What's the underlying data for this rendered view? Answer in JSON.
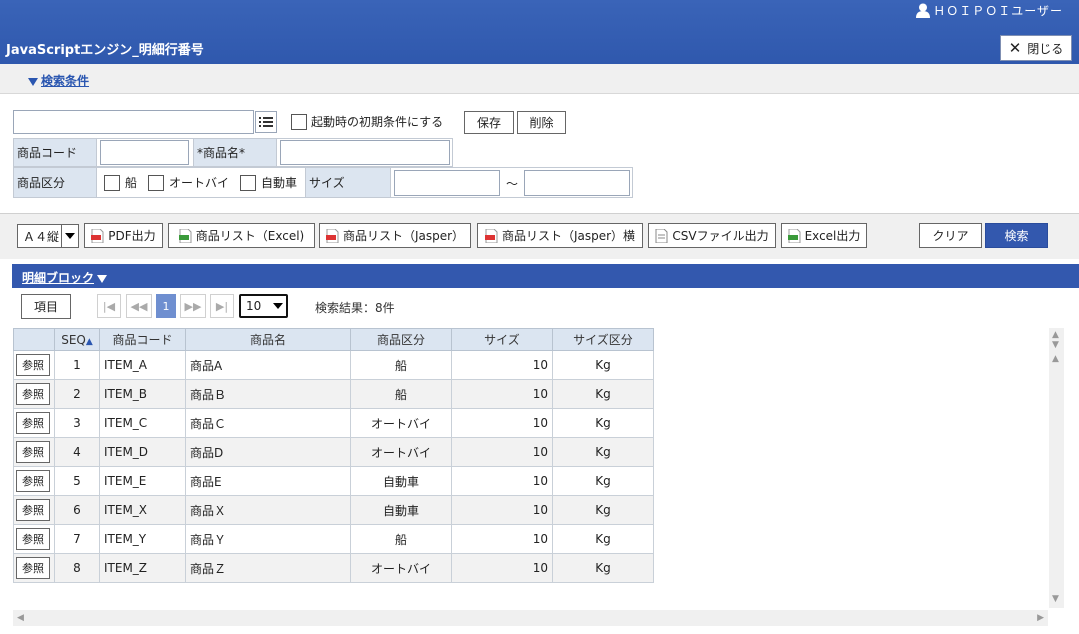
{
  "header": {
    "user": "ＨＯＩＰＯＩユーザー",
    "title": "JavaScriptエンジン_明細行番号",
    "close_label": "閉じる"
  },
  "condition": {
    "toggle_label": "検索条件",
    "preset_value": "",
    "startup_checkbox_label": "起動時の初期条件にする",
    "save_label": "保存",
    "delete_label": "削除",
    "product_code_label": "商品コード",
    "product_code_value": "",
    "product_name_label": "*商品名*",
    "product_name_value": "",
    "category_label": "商品区分",
    "category_options": [
      "船",
      "オートバイ",
      "自動車"
    ],
    "size_label": "サイズ",
    "size_from": "",
    "size_to": "",
    "range_sep": "～"
  },
  "toolbar": {
    "paper_select": "Ａ４縦",
    "pdf_label": "PDF出力",
    "excel_list_label": "商品リスト（Excel)",
    "jasper_list_label": "商品リスト（Jasper）",
    "jasper_list_h_label": "商品リスト（Jasper）横",
    "csv_label": "CSVファイル出力",
    "excel_label": "Excel出力",
    "clear_label": "クリア",
    "search_label": "検索"
  },
  "detail": {
    "toggle_label": "明細ブロック",
    "items_label": "項目",
    "current_page": "1",
    "page_size": "10",
    "result_text": "検索結果：8件"
  },
  "table": {
    "headers": [
      "",
      "SEQ",
      "商品コード",
      "商品名",
      "商品区分",
      "サイズ",
      "サイズ区分"
    ],
    "ref_label": "参照",
    "rows": [
      {
        "seq": "1",
        "code": "ITEM_A",
        "name": "商品A",
        "cat": "船",
        "size": "10",
        "unit": "Kg"
      },
      {
        "seq": "2",
        "code": "ITEM_B",
        "name": "商品Ｂ",
        "cat": "船",
        "size": "10",
        "unit": "Kg"
      },
      {
        "seq": "3",
        "code": "ITEM_C",
        "name": "商品Ｃ",
        "cat": "オートバイ",
        "size": "10",
        "unit": "Kg"
      },
      {
        "seq": "4",
        "code": "ITEM_D",
        "name": "商品D",
        "cat": "オートバイ",
        "size": "10",
        "unit": "Kg"
      },
      {
        "seq": "5",
        "code": "ITEM_E",
        "name": "商品E",
        "cat": "自動車",
        "size": "10",
        "unit": "Kg"
      },
      {
        "seq": "6",
        "code": "ITEM_X",
        "name": "商品Ｘ",
        "cat": "自動車",
        "size": "10",
        "unit": "Kg"
      },
      {
        "seq": "7",
        "code": "ITEM_Y",
        "name": "商品Ｙ",
        "cat": "船",
        "size": "10",
        "unit": "Kg"
      },
      {
        "seq": "8",
        "code": "ITEM_Z",
        "name": "商品Ｚ",
        "cat": "オートバイ",
        "size": "10",
        "unit": "Kg"
      }
    ]
  }
}
